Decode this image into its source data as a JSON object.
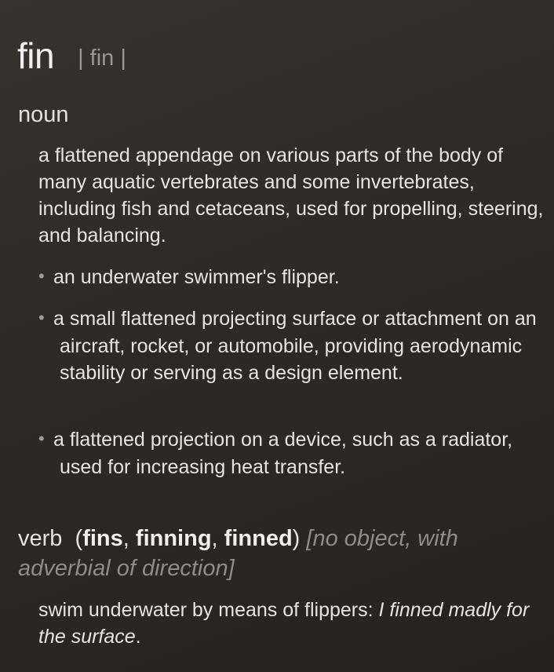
{
  "entry": {
    "headword": "fin",
    "pronunciation": "| fin |"
  },
  "noun": {
    "pos": "noun",
    "definition": "a flattened appendage on various parts of the body of many aquatic vertebrates and some invertebrates, including fish and cetaceans, used for propelling, steering, and balancing.",
    "subsenses": [
      "an underwater swimmer's flipper.",
      "a small flattened projecting surface or attachment on an aircraft, rocket, or automobile, providing aerodynamic stability or serving as a design element.",
      "a flattened projection on a device, such as a radiator, used for increasing heat transfer."
    ],
    "bullet": "•"
  },
  "verb": {
    "pos": "verb",
    "open_paren": "(",
    "forms": [
      "fins",
      "finning",
      "finned"
    ],
    "comma1": ", ",
    "comma2": ", ",
    "close_paren": ")",
    "grammar": "[no object, with adverbial of direction]",
    "definition": "swim underwater by means of flippers: ",
    "example": "I finned madly for the surface",
    "example_end": "."
  }
}
